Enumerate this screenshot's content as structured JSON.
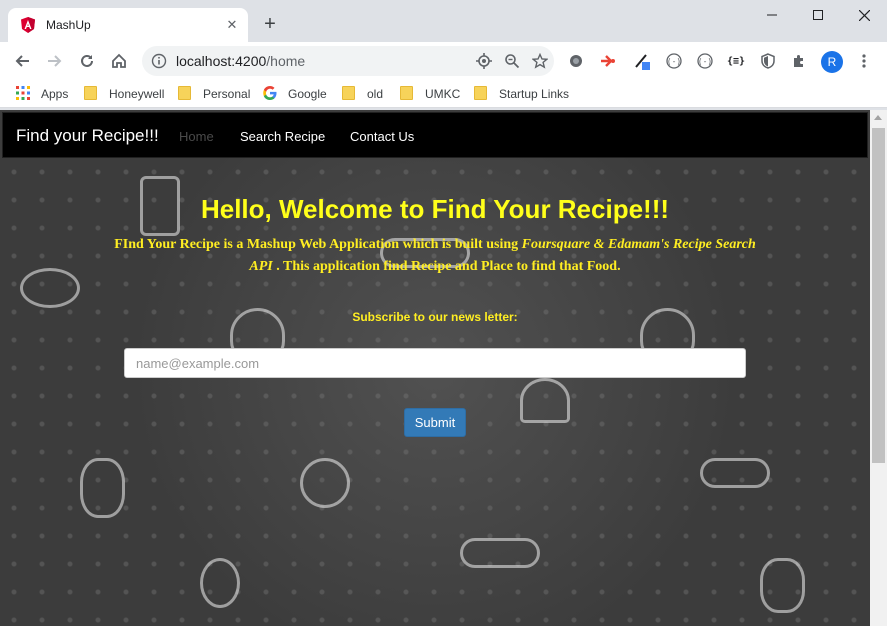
{
  "browser": {
    "tab_title": "MashUp",
    "url_host": "localhost:4200",
    "url_path": "/home",
    "profile_initial": "R",
    "bookmarks": [
      {
        "label": "Apps",
        "icon": "apps-grid-icon"
      },
      {
        "label": "Honeywell",
        "icon": "folder-icon"
      },
      {
        "label": "Personal",
        "icon": "folder-icon"
      },
      {
        "label": "Google",
        "icon": "google-icon"
      },
      {
        "label": "old",
        "icon": "folder-icon"
      },
      {
        "label": "UMKC",
        "icon": "folder-icon"
      },
      {
        "label": "Startup Links",
        "icon": "folder-icon"
      }
    ]
  },
  "navbar": {
    "brand": "Find your Recipe!!!",
    "links": [
      {
        "label": "Home",
        "active": true
      },
      {
        "label": "Search Recipe",
        "active": false
      },
      {
        "label": "Contact Us",
        "active": false
      }
    ]
  },
  "hero": {
    "title_prefix": "Hello, Welcome to ",
    "title_bold": "Find Your Recipe!!!",
    "desc_part1": "FInd Your Recipe is a Mashup Web Application which is built using ",
    "desc_italic": "Foursquare & Edamam's Recipe Search API",
    "desc_part2": " . This application find Recipe and Place to find that Food.",
    "subscribe_label": "Subscribe to our news letter:",
    "email_placeholder": "name@example.com",
    "submit_label": "Submit"
  },
  "colors": {
    "accent_yellow": "#ffff1a",
    "button_blue": "#337ab7",
    "navbar_bg": "#000000"
  }
}
